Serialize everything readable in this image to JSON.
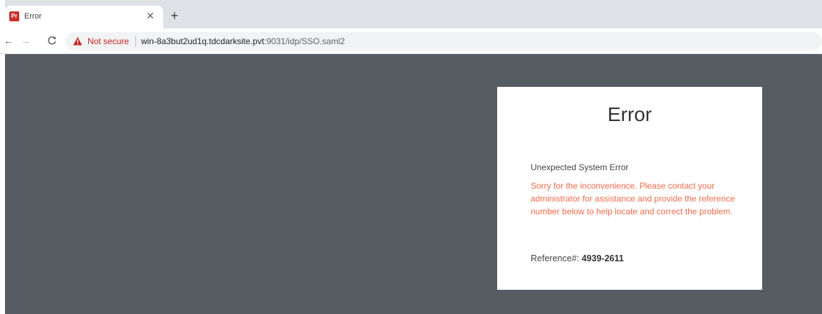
{
  "browser": {
    "tab": {
      "favicon_text": "Pr",
      "title": "Error",
      "close_symbol": "✕"
    },
    "new_tab_symbol": "+",
    "toolbar": {
      "back_symbol": "←",
      "forward_symbol": "→",
      "reload_symbol": "C",
      "security_label": "Not secure",
      "url_host": "win-8a3but2ud1q.tdcdarksite.pvt",
      "url_path": ":9031/idp/SSO.saml2"
    }
  },
  "error_card": {
    "title": "Error",
    "subtitle": "Unexpected System Error",
    "message": "Sorry for the inconvenience. Please contact your administrator for assistance and provide the reference number below to help locate and correct the problem.",
    "reference_label": "Reference#:",
    "reference_value": "4939-2611"
  },
  "colors": {
    "page_background": "#575c63",
    "card_background": "#ffffff",
    "message_color": "#f06a4a",
    "not_secure_color": "#c5221f",
    "favicon_color": "#c9302c"
  },
  "icons": {
    "warning": "warning-triangle-icon",
    "back": "back-arrow-icon",
    "forward": "forward-arrow-icon",
    "reload": "reload-icon",
    "close": "close-icon",
    "new_tab": "plus-icon",
    "favicon": "app-favicon-icon"
  }
}
